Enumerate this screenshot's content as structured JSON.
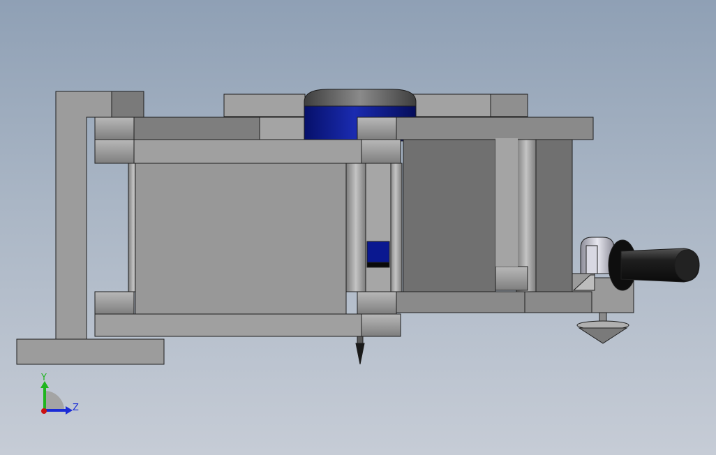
{
  "viewport": {
    "background_top": "#8fa0b5",
    "background_bottom": "#c6ccd6"
  },
  "colors": {
    "part_light": "#9a9a9a",
    "part_mid": "#8a8a8a",
    "part_dark": "#6f6f6f",
    "edge": "#1e1e1e",
    "motor_blue": "#0a1890",
    "motor_cap": "#5a5a5a",
    "handle_black": "#1a1a1a"
  },
  "triad": {
    "y_label": "Y",
    "z_label": "Z",
    "y_color": "#1fb51f",
    "z_color": "#1a2bd6",
    "x_color": "#cc1111"
  }
}
